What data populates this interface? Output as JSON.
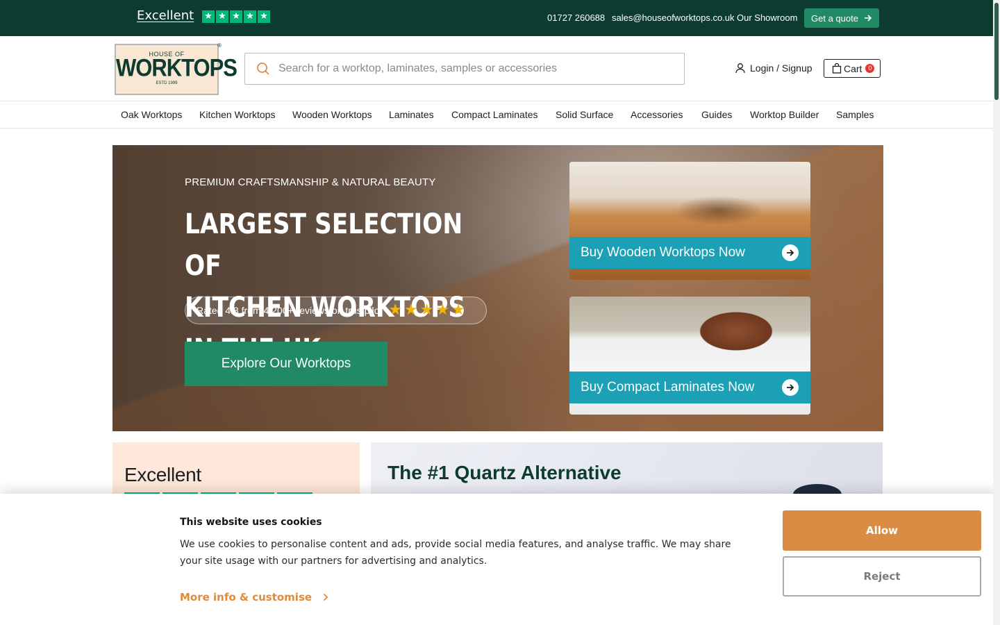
{
  "topbar": {
    "rating_text": "Excellent",
    "phone": "01727 260688",
    "email": "sales@houseofworktops.co.uk",
    "showroom": "Our Showroom",
    "quote_label": "Get a quote"
  },
  "header": {
    "logo": {
      "top": "HOUSE OF",
      "main": "WORKTOPS",
      "est": "ESTD 1999"
    },
    "search_placeholder": "Search for a worktop, laminates, samples or accessories",
    "login_label": "Login / Signup",
    "cart_label": "Cart",
    "cart_count": "0"
  },
  "nav": {
    "items": [
      "Oak Worktops",
      "Kitchen Worktops",
      "Wooden Worktops",
      "Laminates",
      "Compact Laminates",
      "Solid Surface",
      "Accessories",
      "Guides",
      "Worktop Builder",
      "Samples"
    ]
  },
  "hero": {
    "kicker": "PREMIUM CRAFTSMANSHIP & NATURAL BEAUTY",
    "title_line1": "LARGEST SELECTION OF",
    "title_line2": "KITCHEN WORKTOPS IN THE UK",
    "rating_text": "Rated 4.8 from 4,200+ reviews on trustpilot",
    "rating_stars": 5,
    "cta_label": "Explore Our Worktops",
    "promo_wood_label": "Buy Wooden Worktops Now",
    "promo_compact_label": "Buy Compact Laminates Now"
  },
  "below": {
    "excellent_title": "Excellent",
    "quartz_title": "The #1 Quartz Alternative"
  },
  "cookie": {
    "title": "This website uses cookies",
    "body": "We use cookies to personalise content and ads, provide social media features, and analyse traffic. We may share your site usage with our partners for advertising and analytics.",
    "more_label": "More info & customise",
    "allow_label": "Allow",
    "reject_label": "Reject"
  },
  "colors": {
    "topbar_bg": "#0e3b30",
    "accent_green": "#1f8a63",
    "trustpilot_green": "#00b67a",
    "promo_teal": "#1ba0b6",
    "cookie_accent": "#d98c44"
  },
  "icons": [
    "star-icon",
    "arrow-right-icon",
    "search-icon",
    "user-icon",
    "shopping-bag-icon",
    "chevron-right-icon"
  ]
}
